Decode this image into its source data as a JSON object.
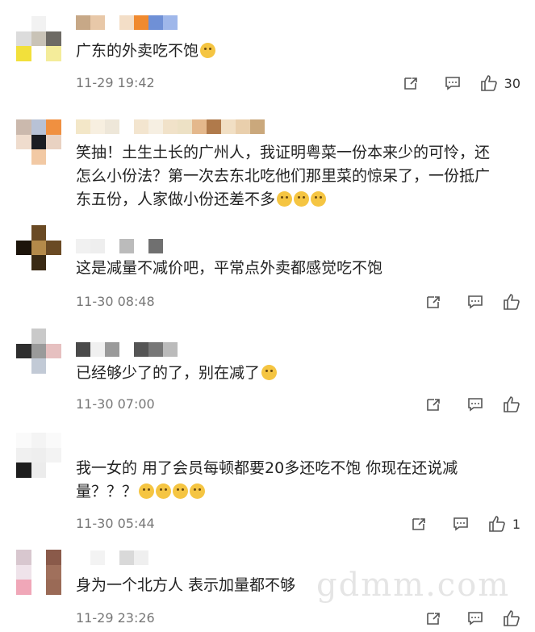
{
  "comments": [
    {
      "text": "广东的外卖吃不饱",
      "emoji": [
        "smile"
      ],
      "time": "11-29 19:42",
      "likes": "30"
    },
    {
      "text": "笑抽！土生土长的广州人，我证明粤菜一份本来少的可怜，还怎么小份法？第一次去东北吃他们那里菜的惊呆了，一份抵广东五份，人家做小份还差不多",
      "emoji": [
        "laugh",
        "laugh",
        "laugh"
      ],
      "time": "",
      "likes": ""
    },
    {
      "text": "这是减量不减价吧，平常点外卖都感觉吃不饱",
      "emoji": [],
      "time": "11-30 08:48",
      "likes": ""
    },
    {
      "text": "已经够少了的了，别在减了",
      "emoji": [
        "eyeroll"
      ],
      "time": "11-30 07:00",
      "likes": ""
    },
    {
      "text": "我一女的 用了会员每顿都要20多还吃不饱 你现在还说减量？？？",
      "emoji": [
        "smile",
        "smile",
        "smile",
        "smile"
      ],
      "time": "11-30 05:44",
      "likes": "1"
    },
    {
      "text": "身为一个北方人 表示加量都不够",
      "emoji": [],
      "time": "11-29 23:26",
      "likes": ""
    }
  ],
  "watermark": "gdmm.com",
  "icons": [
    "share-icon",
    "comment-icon",
    "thumbs-up-icon"
  ]
}
